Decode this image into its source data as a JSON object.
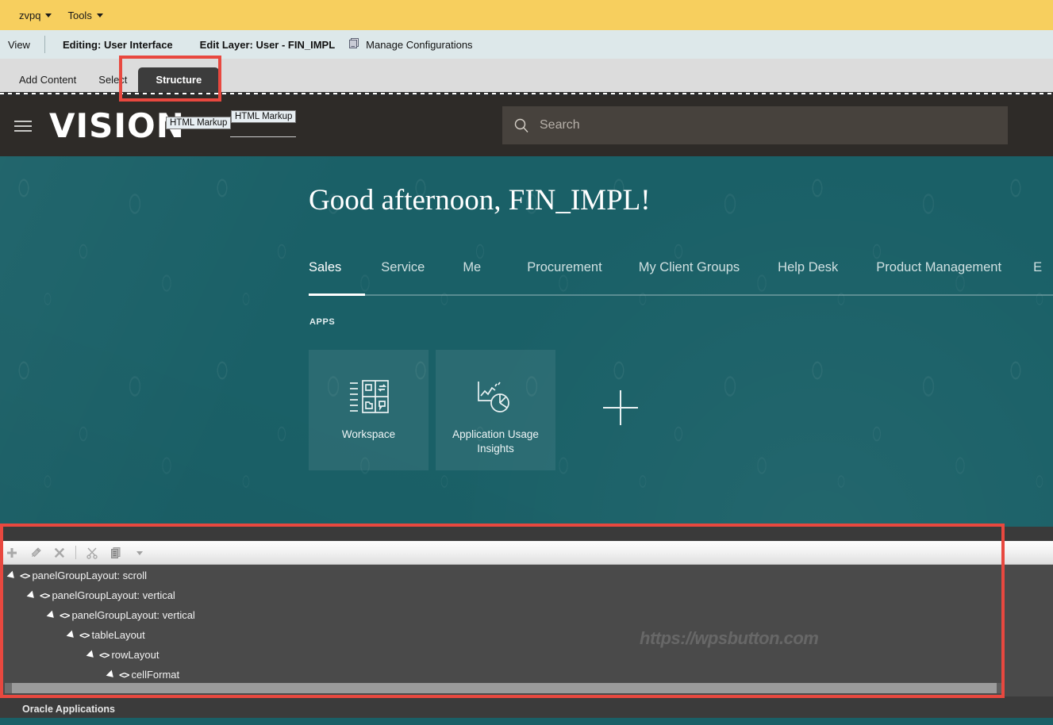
{
  "composer": {
    "user_menu": "zvpq",
    "tools_menu": "Tools"
  },
  "edit_bar": {
    "view": "View",
    "editing": "Editing: User Interface",
    "edit_layer": "Edit Layer: User - FIN_IMPL",
    "manage_configurations": "Manage Configurations"
  },
  "tool_strip": {
    "tabs": [
      {
        "label": "Add Content",
        "active": false
      },
      {
        "label": "Select",
        "active": false
      },
      {
        "label": "Structure",
        "active": true
      }
    ]
  },
  "app_header": {
    "brand": "VISION",
    "markup_tag_1": "HTML Markup",
    "markup_tag_2": "HTML Markup",
    "search_placeholder": "Search",
    "search_value": ""
  },
  "hero": {
    "greeting": "Good afternoon, FIN_IMPL!",
    "tabs": [
      {
        "label": "Sales",
        "active": true
      },
      {
        "label": "Service",
        "active": false
      },
      {
        "label": "Me",
        "active": false
      },
      {
        "label": "Procurement",
        "active": false
      },
      {
        "label": "My Client Groups",
        "active": false
      },
      {
        "label": "Help Desk",
        "active": false
      },
      {
        "label": "Product Management",
        "active": false
      },
      {
        "label": "E",
        "active": false
      }
    ],
    "apps_label": "APPS",
    "apps": [
      {
        "title": "Workspace",
        "icon": "workspace-grid-icon"
      },
      {
        "title": "Application Usage Insights",
        "icon": "analytics-chart-icon"
      }
    ],
    "add_app_label": "Add"
  },
  "structure_panel": {
    "toolbar": [
      {
        "name": "add",
        "glyph": "plus-icon"
      },
      {
        "name": "edit",
        "glyph": "wand-icon"
      },
      {
        "name": "delete",
        "glyph": "close-x-icon"
      },
      {
        "name": "cut",
        "glyph": "scissors-icon"
      },
      {
        "name": "copy",
        "glyph": "copy-icon"
      },
      {
        "name": "more",
        "glyph": "chevron-down-icon"
      }
    ],
    "tree": [
      {
        "label": "panelGroupLayout: scroll",
        "depth": 0
      },
      {
        "label": "panelGroupLayout: vertical",
        "depth": 1
      },
      {
        "label": "panelGroupLayout: vertical",
        "depth": 2
      },
      {
        "label": "tableLayout",
        "depth": 3
      },
      {
        "label": "rowLayout",
        "depth": 4
      },
      {
        "label": "cellFormat",
        "depth": 5
      }
    ],
    "watermark": "https://wpsbutton.com"
  },
  "footer": {
    "text": "Oracle Applications"
  },
  "colors": {
    "composer_yellow": "#f7cf5e",
    "edit_bar_blue": "#dde8ea",
    "tool_strip_grey": "#dcdcdc",
    "active_tab_dark": "#3c3c3c",
    "app_header_dark": "#2e2b28",
    "hero_teal": "#1a6067",
    "panel_grey": "#4a4a4a",
    "annotation_red": "#e8483f",
    "footer_dark": "#3b3b3b"
  }
}
